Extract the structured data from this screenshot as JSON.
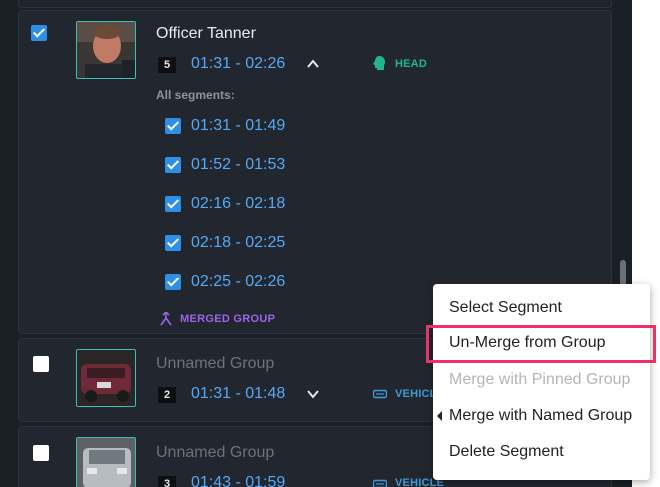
{
  "groups": [
    {
      "name": "Officer Tanner",
      "count": "5",
      "time_range": "01:31 - 02:26",
      "tag": "HEAD",
      "checked": true,
      "segments_label": "All segments:",
      "segments": [
        "01:31 - 01:49",
        "01:52 - 01:53",
        "02:16 - 02:18",
        "02:18 - 02:25",
        "02:25 - 02:26"
      ],
      "merged_label": "MERGED GROUP"
    },
    {
      "name": "Unnamed Group",
      "count": "2",
      "time_range": "01:31 - 01:48",
      "tag": "VEHICLE",
      "checked": false
    },
    {
      "name": "Unnamed Group",
      "count": "3",
      "time_range": "01:43 - 01:59",
      "tag": "VEHICLE",
      "checked": false
    }
  ],
  "context_menu": {
    "items": [
      {
        "label": "Select Segment",
        "state": "normal"
      },
      {
        "label": "Un-Merge from Group",
        "state": "highlighted"
      },
      {
        "label": "Merge with Pinned Group",
        "state": "disabled"
      },
      {
        "label": "Merge with Named Group",
        "state": "submenu"
      },
      {
        "label": "Delete Segment",
        "state": "normal"
      }
    ]
  },
  "colors": {
    "accent_blue": "#56a8f5",
    "head_tag": "#22b58f",
    "vehicle_tag": "#3e9ad8",
    "merged": "#9c64e8",
    "highlight": "#ec3069"
  },
  "icons": {
    "head": "head-silhouette-icon",
    "vehicle": "vehicle-icon",
    "merged": "merge-icon",
    "expand": "chevron-up-icon",
    "collapse": "chevron-down-icon"
  }
}
